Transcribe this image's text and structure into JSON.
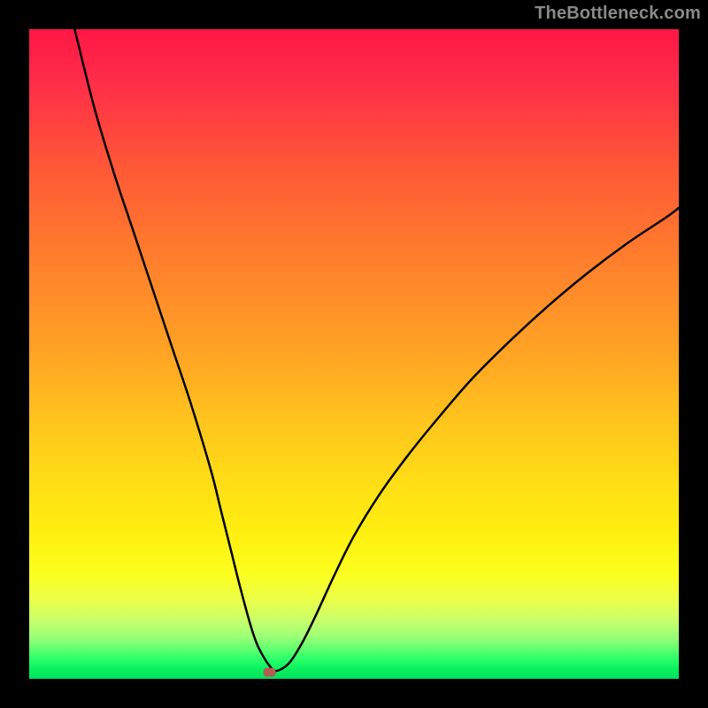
{
  "watermark": "TheBottleneck.com",
  "chart_data": {
    "type": "line",
    "title": "",
    "xlabel": "",
    "ylabel": "",
    "xlim": [
      0,
      100
    ],
    "ylim": [
      0,
      100
    ],
    "grid": false,
    "legend": false,
    "series": [
      {
        "name": "curve",
        "x": [
          7,
          10,
          13,
          16,
          19,
          22,
          25,
          28,
          29.5,
          31,
          32.5,
          34,
          35,
          36,
          37,
          38,
          40,
          42,
          44,
          47,
          50,
          54,
          58,
          62,
          68,
          74,
          80,
          86,
          92,
          98,
          100
        ],
        "y": [
          100,
          88,
          78,
          69,
          60,
          51,
          42,
          32,
          26,
          20,
          14,
          8.5,
          5.5,
          3.5,
          2,
          1.2,
          2.4,
          5.5,
          9.5,
          16,
          22,
          28.5,
          34,
          39,
          46,
          52,
          57.5,
          62.5,
          67,
          71,
          72.5
        ]
      }
    ],
    "marker": {
      "x": 37,
      "y": 1,
      "color": "#b65b4f"
    },
    "background_gradient": {
      "top": "#ff1744",
      "mid": "#ffde16",
      "bottom": "#00e25c"
    }
  }
}
